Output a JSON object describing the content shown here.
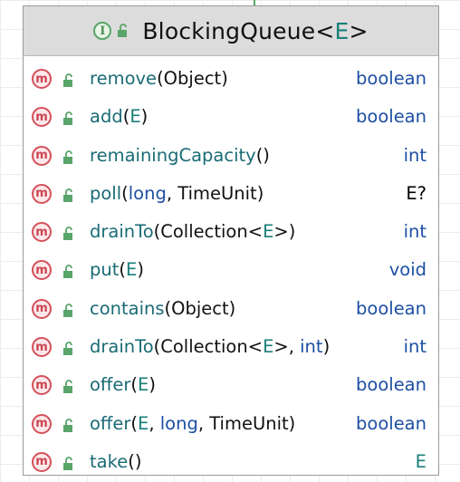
{
  "diagram": {
    "connector_color": "#59a869",
    "header": {
      "kind_icon": "interface-icon",
      "kind_letter": "I",
      "visibility_icon": "public-lock-icon",
      "class_name": "BlockingQueue",
      "type_param_open": "<",
      "type_param": "E",
      "type_param_close": ">"
    },
    "methods": [
      {
        "name": "remove",
        "params": [
          {
            "text": "Object",
            "kind": "type"
          }
        ],
        "return_type": "boolean",
        "return_kind": "prim"
      },
      {
        "name": "add",
        "params": [
          {
            "text": "E",
            "kind": "generic"
          }
        ],
        "return_type": "boolean",
        "return_kind": "prim"
      },
      {
        "name": "remainingCapacity",
        "params": [],
        "return_type": "int",
        "return_kind": "prim"
      },
      {
        "name": "poll",
        "params": [
          {
            "text": "long",
            "kind": "prim"
          },
          {
            "text": "TimeUnit",
            "kind": "type"
          }
        ],
        "return_type": "E?",
        "return_kind": "type"
      },
      {
        "name": "drainTo",
        "params": [
          {
            "text": "Collection<",
            "kind": "type",
            "join": "Collection<E>"
          }
        ],
        "return_type": "int",
        "return_kind": "prim"
      },
      {
        "name": "put",
        "params": [
          {
            "text": "E",
            "kind": "generic"
          }
        ],
        "return_type": "void",
        "return_kind": "prim"
      },
      {
        "name": "contains",
        "params": [
          {
            "text": "Object",
            "kind": "type"
          }
        ],
        "return_type": "boolean",
        "return_kind": "prim"
      },
      {
        "name": "drainTo",
        "params": [
          {
            "text": "Collection<",
            "kind": "type",
            "join": "Collection<E>"
          },
          {
            "text": "int",
            "kind": "prim"
          }
        ],
        "return_type": "int",
        "return_kind": "prim"
      },
      {
        "name": "offer",
        "params": [
          {
            "text": "E",
            "kind": "generic"
          }
        ],
        "return_type": "boolean",
        "return_kind": "prim"
      },
      {
        "name": "offer",
        "params": [
          {
            "text": "E",
            "kind": "generic"
          },
          {
            "text": "long",
            "kind": "prim"
          },
          {
            "text": "TimeUnit",
            "kind": "type"
          }
        ],
        "return_type": "boolean",
        "return_kind": "prim"
      },
      {
        "name": "take",
        "params": [],
        "return_type": "E",
        "return_kind": "generic"
      }
    ],
    "method_icon_letter": "m",
    "method_icon": "method-icon",
    "member_visibility_icon": "public-lock-icon"
  }
}
